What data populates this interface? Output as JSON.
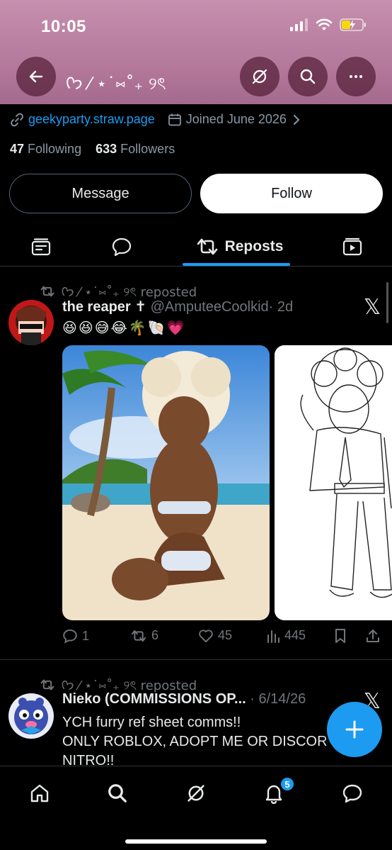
{
  "status_bar": {
    "time": "10:05"
  },
  "header": {
    "display_name": "ᢉ𐭩 ⁄ ⋆˙⑅˚₊ ୨ৎ"
  },
  "profile": {
    "link": "geekyparty.straw.page",
    "joined": "Joined June 2026",
    "following_count": "47",
    "following_label": "Following",
    "followers_count": "633",
    "followers_label": "Followers",
    "message_label": "Message",
    "follow_label": "Follow"
  },
  "tabs": {
    "active_label": "Reposts"
  },
  "posts": [
    {
      "repost_text": "ᢉ𐭩 ⁄ ⋆˙⑅˚₊ ୨ৎ reposted",
      "author_name": "the reaper ✝",
      "author_handle": "@AmputeeCoolkid",
      "time": "· 2d",
      "emojis": "😆😆😅😂🌴🐚💗",
      "replies": "1",
      "reposts": "6",
      "likes": "45",
      "views": "445"
    },
    {
      "repost_text": "ᢉ𐭩 ⁄ ⋆˙⑅˚₊ ୨ৎ reposted",
      "author_name": "Nieko (COMMISSIONS OP...",
      "time": "· 6/14/26",
      "text_line1": "YCH furry ref sheet comms!!",
      "text_line2": "ONLY ROBLOX, ADOPT ME OR DISCOR",
      "text_line3": "NITRO!!"
    }
  ],
  "notifications": {
    "badge": "5"
  },
  "colors": {
    "accent": "#1d9bf0",
    "banner": "#b57a9c",
    "background": "#000000"
  },
  "x_logo": "𝕏"
}
